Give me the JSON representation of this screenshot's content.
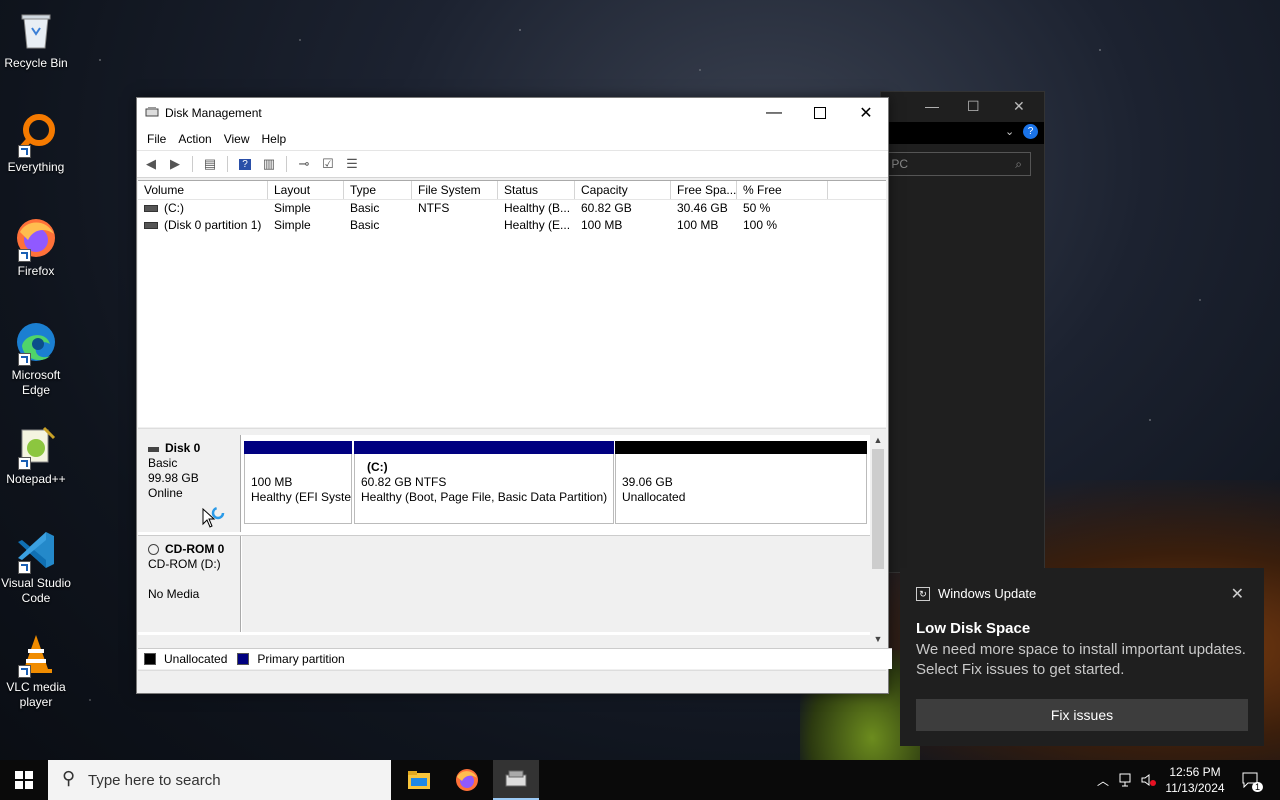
{
  "desktop": {
    "icons": [
      {
        "label": "Recycle Bin"
      },
      {
        "label": "Everything"
      },
      {
        "label": "Firefox"
      },
      {
        "label": "Microsoft Edge"
      },
      {
        "label": "Notepad++"
      },
      {
        "label": "Visual Studio Code"
      },
      {
        "label": "VLC media player"
      }
    ]
  },
  "bg_window": {
    "search_placeholder": "s PC"
  },
  "window": {
    "title": "Disk Management",
    "menu": [
      "File",
      "Action",
      "View",
      "Help"
    ],
    "columns": [
      "Volume",
      "Layout",
      "Type",
      "File System",
      "Status",
      "Capacity",
      "Free Spa...",
      "% Free"
    ],
    "rows": [
      [
        "(C:)",
        "Simple",
        "Basic",
        "NTFS",
        "Healthy (B...",
        "60.82 GB",
        "30.46 GB",
        "50 %"
      ],
      [
        "(Disk 0 partition 1)",
        "Simple",
        "Basic",
        "",
        "Healthy (E...",
        "100 MB",
        "100 MB",
        "100 %"
      ]
    ],
    "disks": [
      {
        "name": "Disk 0",
        "type": "Basic",
        "size": "99.98 GB",
        "state": "Online",
        "partitions": [
          {
            "title": "",
            "line1": "100 MB",
            "line2": "Healthy (EFI Syste"
          },
          {
            "title": "(C:)",
            "line1": "60.82 GB NTFS",
            "line2": "Healthy (Boot, Page File, Basic Data Partition)"
          },
          {
            "title": "",
            "line1": "39.06 GB",
            "line2": "Unallocated"
          }
        ]
      },
      {
        "name": "CD-ROM 0",
        "type": "CD-ROM (D:)",
        "state": "No Media"
      }
    ],
    "legend": [
      "Unallocated",
      "Primary partition"
    ]
  },
  "toast": {
    "app": "Windows Update",
    "title": "Low Disk Space",
    "message": "We need more space to install important updates. Select Fix issues to get started.",
    "button": "Fix issues"
  },
  "taskbar": {
    "search_placeholder": "Type here to search",
    "time": "12:56 PM",
    "date": "11/13/2024",
    "notification_count": "1"
  },
  "colors": {
    "primary_partition": "#000080",
    "unallocated": "#000000",
    "toast_bg": "#1f1f1f"
  }
}
